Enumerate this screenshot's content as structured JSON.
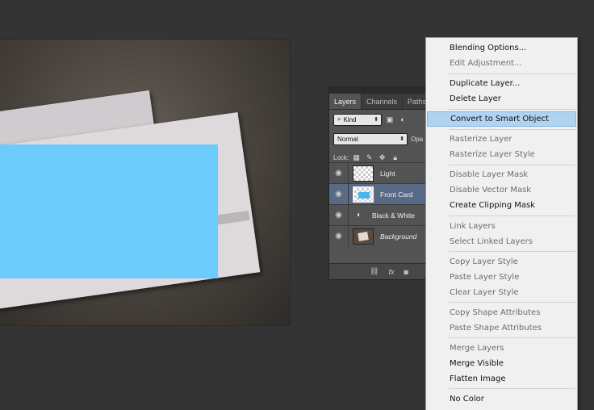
{
  "layers_panel": {
    "tabs": [
      "Layers",
      "Channels",
      "Paths"
    ],
    "kind_filter": "Kind",
    "blend_mode": "Normal",
    "opacity_label": "Opa",
    "lock_label": "Lock:",
    "layers": [
      {
        "name": "Light",
        "thumb": "transparent"
      },
      {
        "name": "Front Card",
        "thumb": "card"
      },
      {
        "name": "Black & White",
        "thumb": "adjustment"
      },
      {
        "name": "Background",
        "thumb": "photo"
      }
    ],
    "footer_fx": "fx"
  },
  "context_menu": {
    "items": [
      {
        "label": "Blending Options...",
        "enabled": true
      },
      {
        "label": "Edit Adjustment...",
        "enabled": false
      },
      {
        "label": "Duplicate Layer...",
        "enabled": true
      },
      {
        "label": "Delete Layer",
        "enabled": true
      },
      {
        "label": "Convert to Smart Object",
        "enabled": true,
        "highlighted": true
      },
      {
        "label": "Rasterize Layer",
        "enabled": false
      },
      {
        "label": "Rasterize Layer Style",
        "enabled": false
      },
      {
        "label": "Disable Layer Mask",
        "enabled": false
      },
      {
        "label": "Disable Vector Mask",
        "enabled": false
      },
      {
        "label": "Create Clipping Mask",
        "enabled": true
      },
      {
        "label": "Link Layers",
        "enabled": false
      },
      {
        "label": "Select Linked Layers",
        "enabled": false
      },
      {
        "label": "Copy Layer Style",
        "enabled": false
      },
      {
        "label": "Paste Layer Style",
        "enabled": false
      },
      {
        "label": "Clear Layer Style",
        "enabled": false
      },
      {
        "label": "Copy Shape Attributes",
        "enabled": false
      },
      {
        "label": "Paste Shape Attributes",
        "enabled": false
      },
      {
        "label": "Merge Layers",
        "enabled": false
      },
      {
        "label": "Merge Visible",
        "enabled": true
      },
      {
        "label": "Flatten Image",
        "enabled": true
      },
      {
        "label": "No Color",
        "enabled": true
      }
    ]
  },
  "colors": {
    "workspace": "#343434",
    "menu_bg": "#f0f0f0",
    "menu_highlight": "#b0d3f0",
    "card_blue": "#6dcbfb",
    "selected_layer": "#586a85"
  }
}
